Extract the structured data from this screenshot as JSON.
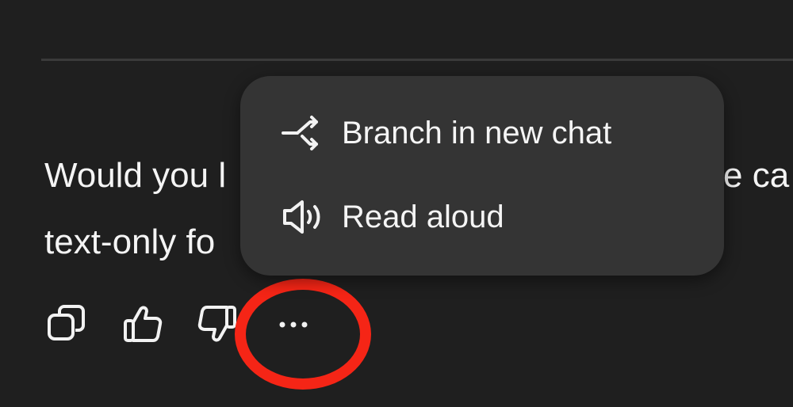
{
  "message": {
    "line1_start": "Would you l",
    "line1_end": "e ca",
    "line2_start": "text-only fo"
  },
  "actions": {
    "copy_icon": "copy-icon",
    "thumbs_up_icon": "thumbs-up-icon",
    "thumbs_down_icon": "thumbs-down-icon",
    "more_icon": "more-horizontal-icon"
  },
  "menu": {
    "items": [
      {
        "label": "Branch in new chat",
        "icon": "branch-icon"
      },
      {
        "label": "Read aloud",
        "icon": "speaker-icon"
      }
    ]
  },
  "colors": {
    "background": "#1f1f1f",
    "menu_background": "#343434",
    "highlight": "#f52516"
  }
}
